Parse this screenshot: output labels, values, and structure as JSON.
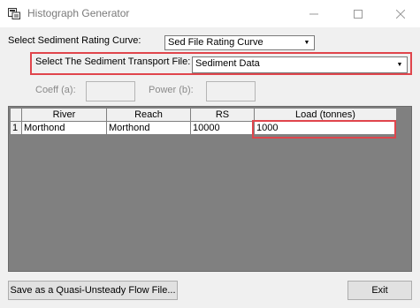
{
  "window": {
    "title": "Histograph Generator"
  },
  "rating_curve": {
    "label": "Select Sediment Rating Curve:",
    "selected": "Sed File Rating Curve"
  },
  "transport_file": {
    "label": "Select The Sediment Transport File:",
    "selected": "Sediment Data"
  },
  "coeff": {
    "label": "Coeff (a):",
    "value": ""
  },
  "power": {
    "label": "Power (b):",
    "value": ""
  },
  "table": {
    "headers": [
      "River",
      "Reach",
      "RS",
      "Load (tonnes)"
    ],
    "rows": [
      {
        "num": "1",
        "river": "Morthond",
        "reach": "Morthond",
        "rs": "10000",
        "load": "1000"
      }
    ]
  },
  "buttons": {
    "save": "Save as a Quasi-Unsteady Flow File...",
    "exit": "Exit"
  },
  "colors": {
    "highlight": "#e0454c",
    "grid_bg": "#808080",
    "window_bg": "#f0f0f0"
  }
}
